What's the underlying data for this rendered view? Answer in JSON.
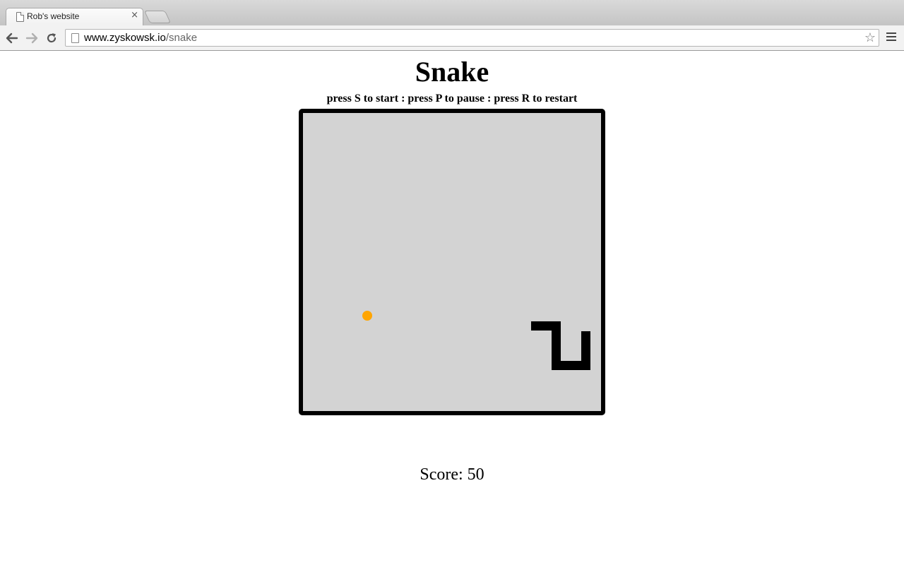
{
  "browser": {
    "tab": {
      "title": "Rob's website",
      "close_glyph": "×"
    },
    "address_bar": {
      "host": "www.zyskowsk.io",
      "path": "/snake"
    },
    "bookmark_glyph": "☆",
    "icons": [
      "back-arrow-icon",
      "forward-arrow-icon",
      "reload-icon",
      "page-icon",
      "star-icon",
      "menu-icon"
    ]
  },
  "page": {
    "title": "Snake",
    "instructions": "press S to start : press P to pause : press R to restart",
    "score_text": "Score: 50"
  },
  "game": {
    "board_color": "#d3d3d3",
    "border_color": "#000000",
    "snake_color": "#000000",
    "food_color": "#ffa500"
  }
}
